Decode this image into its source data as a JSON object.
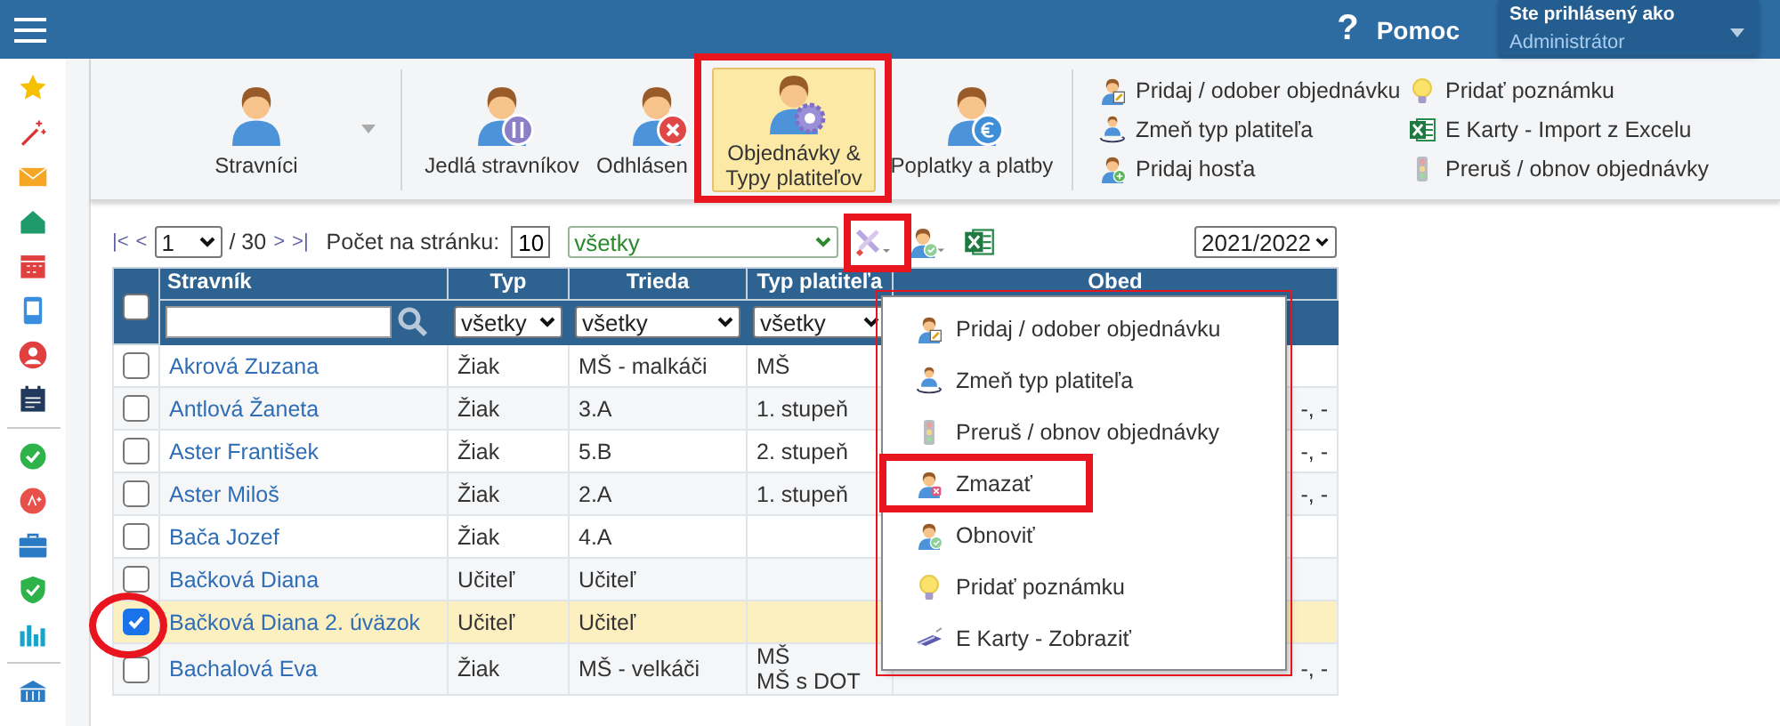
{
  "top_bar": {
    "help": {
      "icon": "?",
      "label": "Pomoc"
    },
    "user": {
      "caption": "Ste prihlásený ako",
      "name": "Administrátor"
    }
  },
  "ribbon": {
    "large_buttons": [
      {
        "label": "Stravníci",
        "selected": false
      },
      {
        "label": "Jedlá stravníkov",
        "selected": false
      },
      {
        "label": "Odhlásen",
        "selected": false
      },
      {
        "label": "Objednávky &\nTypy platiteľov",
        "selected": true
      },
      {
        "label": "Poplatky a platby",
        "selected": false
      }
    ],
    "small_actions": [
      {
        "label": "Pridaj / odober objednávku"
      },
      {
        "label": "Zmeň typ platiteľa"
      },
      {
        "label": "Pridaj hosťa"
      },
      {
        "label": "Pridať poznámku"
      },
      {
        "label": "E Karty - Import z Excelu"
      },
      {
        "label": "Preruš / obnov objednávky"
      }
    ]
  },
  "pager": {
    "first": "|<",
    "prev": "<",
    "page": "1",
    "total": "/ 30",
    "next": ">",
    "last": ">|",
    "page_size_label": "Počet na stránku:",
    "page_size": "10",
    "filter": "všetky",
    "year": "2021/2022"
  },
  "table": {
    "columns": [
      "Stravník",
      "Typ",
      "Trieda",
      "Typ platiteľa",
      "Obed"
    ],
    "header_checked": false,
    "filters": [
      "všetky",
      "všetky",
      "všetky"
    ],
    "rows": [
      {
        "name": "Akrová Zuzana",
        "type": "Žiak",
        "class": "MŠ - malkáči",
        "payer": "MŠ",
        "checked": false,
        "selected": false
      },
      {
        "name": "Antlová Žaneta",
        "type": "Žiak",
        "class": "3.A",
        "payer": "1. stupeň",
        "lunch": "-, -",
        "checked": false,
        "selected": false
      },
      {
        "name": "Aster František",
        "type": "Žiak",
        "class": "5.B",
        "payer": "2. stupeň",
        "lunch": "-, -",
        "checked": false,
        "selected": false
      },
      {
        "name": "Aster Miloš",
        "type": "Žiak",
        "class": "2.A",
        "payer": "1. stupeň",
        "lunch": "-, -",
        "checked": false,
        "selected": false
      },
      {
        "name": "Bača Jozef",
        "type": "Žiak",
        "class": "4.A",
        "checked": false,
        "selected": false
      },
      {
        "name": "Bačková Diana",
        "type": "Učiteľ",
        "class": "Učiteľ",
        "checked": false,
        "selected": false
      },
      {
        "name": "Bačková Diana 2. úväzok",
        "type": "Učiteľ",
        "class": "Učiteľ",
        "checked": true,
        "selected": true
      },
      {
        "name": "Bachalová Eva",
        "type": "Žiak",
        "class": "MŠ - velkáči",
        "payer": "MŠ\nMŠ s DOT",
        "lunch": "-, -",
        "checked": false,
        "selected": false
      }
    ]
  },
  "context_menu": {
    "items": [
      {
        "label": "Pridaj / odober objednávku",
        "highlighted": false
      },
      {
        "label": "Zmeň typ platiteľa",
        "highlighted": false
      },
      {
        "label": "Preruš / obnov objednávky",
        "highlighted": false
      },
      {
        "label": "Zmazať",
        "highlighted": true
      },
      {
        "label": "Obnoviť",
        "highlighted": false
      },
      {
        "label": "Pridať poznámku",
        "highlighted": false
      },
      {
        "label": "E Karty - Zobraziť",
        "highlighted": false
      }
    ]
  }
}
